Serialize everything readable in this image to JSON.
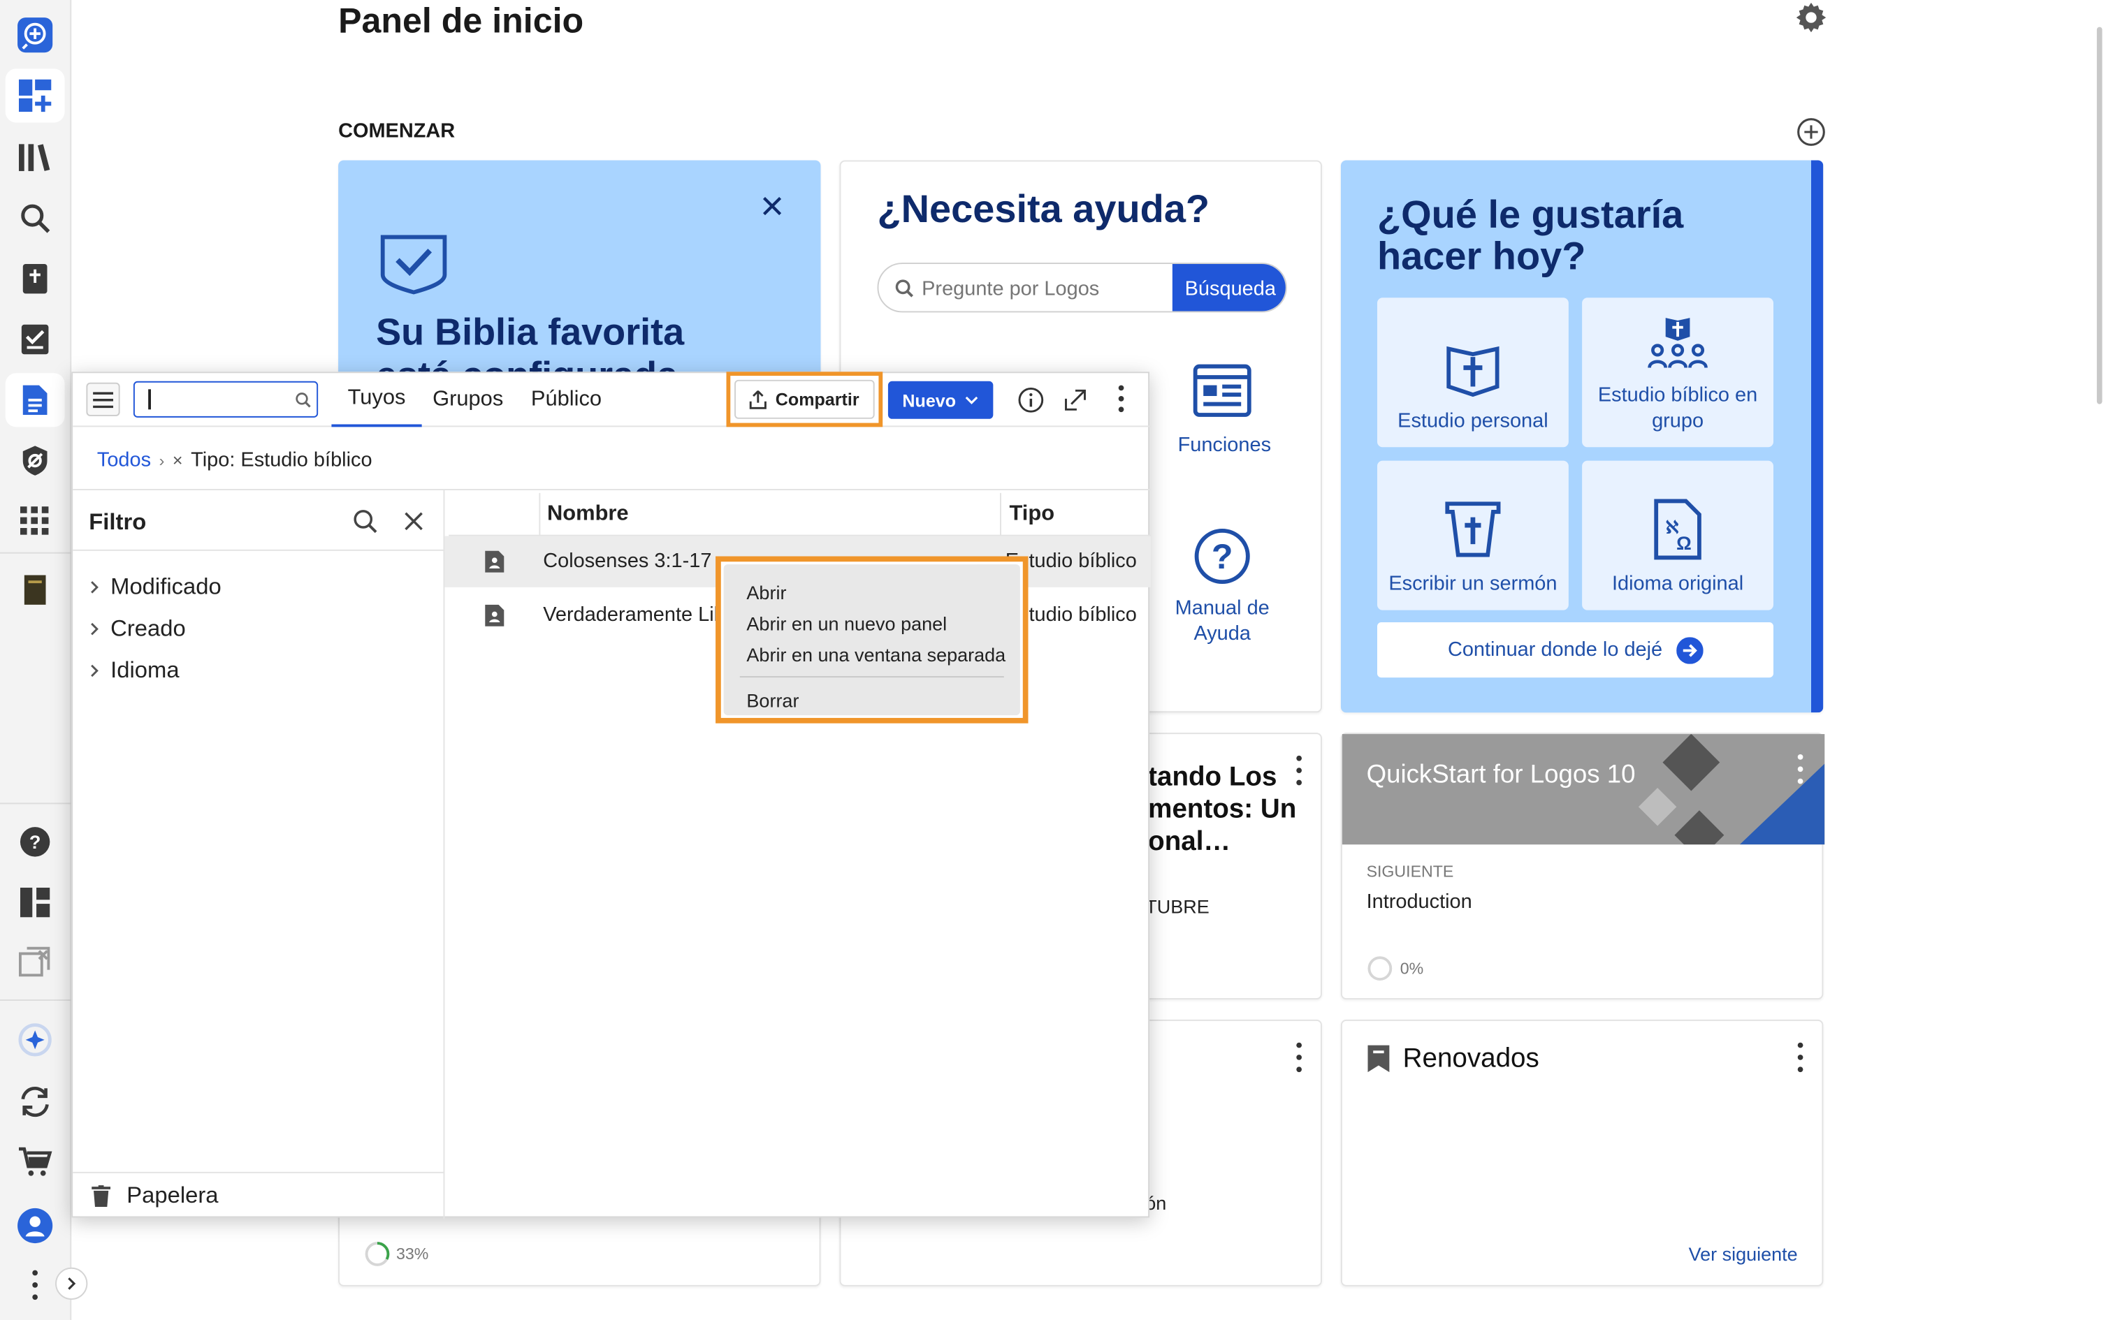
{
  "rail": {
    "icons": [
      "search-plus-icon",
      "dashboard-add-icon",
      "library-icon",
      "search-icon",
      "bible-icon",
      "checklist-icon",
      "documents-icon",
      "shield-icon",
      "apps-grid-icon",
      "book-icon",
      "help-icon",
      "layouts-icon",
      "close-panels-icon",
      "ai-assistant-icon",
      "sync-icon",
      "cart-icon",
      "account-icon",
      "more-icon",
      "expand-icon"
    ]
  },
  "dashboard": {
    "title": "Panel de inicio",
    "section": "COMENZAR",
    "favorite_card": {
      "title_line1": "Su Biblia favorita",
      "title_line2": "está configurada"
    },
    "help_card": {
      "title": "¿Necesita ayuda?",
      "search_placeholder": "Pregunte por Logos",
      "search_button": "Búsqueda",
      "links": [
        {
          "label": "Funciones"
        },
        {
          "label": "Manual de Ayuda"
        }
      ]
    },
    "todo_card": {
      "title": "¿Qué le gustaría hacer hoy?",
      "tiles": [
        {
          "label": "Estudio personal"
        },
        {
          "label": "Estudio bíblico en grupo"
        },
        {
          "label": "Escribir un sermón"
        },
        {
          "label": "Idioma original"
        }
      ],
      "continue_label": "Continuar donde lo dejé"
    },
    "partial_card": {
      "title": "…tando Los …mentos: Un …onal…",
      "line1": "tando Los",
      "line2": "mentos: Un",
      "line3": "onal…",
      "meta": "TUBRE"
    },
    "partial_card2": {
      "text": "ón"
    },
    "progress_card": {
      "progress": 0.33,
      "progress_label": "33%"
    },
    "quickstart": {
      "title": "QuickStart for Logos 10",
      "next_label": "SIGUIENTE",
      "next_item": "Introduction",
      "progress": 0,
      "progress_label": "0%"
    },
    "renovados": {
      "title": "Renovados",
      "link": "Ver siguiente"
    }
  },
  "library": {
    "search_value": "",
    "tabs": [
      {
        "label": "Tuyos",
        "active": true
      },
      {
        "label": "Grupos"
      },
      {
        "label": "Público"
      }
    ],
    "share_label": "Compartir",
    "new_label": "Nuevo",
    "breadcrumb": {
      "root": "Todos",
      "separator": "›",
      "filter": "Tipo: Estudio bíblico"
    },
    "filter": {
      "title": "Filtro",
      "items": [
        {
          "label": "Modificado"
        },
        {
          "label": "Creado"
        },
        {
          "label": "Idioma"
        }
      ],
      "trash": "Papelera"
    },
    "columns": {
      "name": "Nombre",
      "type": "Tipo"
    },
    "rows": [
      {
        "name": "Colosenses 3:1-17",
        "type": "Estudio bíblico"
      },
      {
        "name": "Verdaderamente Libre",
        "type": "Estudio bíblico"
      }
    ],
    "context_menu": {
      "items": [
        "Abrir",
        "Abrir en un nuevo panel",
        "Abrir en una ventana separada",
        "Borrar"
      ]
    }
  },
  "colors": {
    "accent": "#2156d8",
    "navy": "#0e2a6b",
    "highlight": "#f0952a",
    "tile_bg": "#e8f2ff",
    "card_blue": "#a9d4ff"
  }
}
